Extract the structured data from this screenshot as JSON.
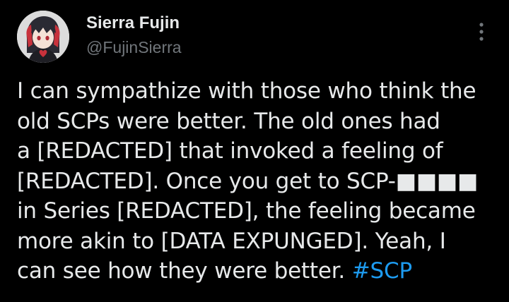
{
  "author": {
    "display_name": "Sierra Fujin",
    "handle": "@FujinSierra",
    "avatar_icon": "anime-avatar-icon"
  },
  "more_icon": "vertical-ellipsis-icon",
  "tweet": {
    "lines": [
      "I can sympathize with those who think the",
      "old SCPs were better. The old ones had",
      "a [REDACTED] that invoked a feeling of",
      "[REDACTED]. Once you get to SCP-■■■■",
      "in Series [REDACTED], the feeling became",
      "more akin to [DATA EXPUNGED]. Yeah, I"
    ],
    "last_line_text": "can see how they were better. ",
    "hashtag": "#SCP"
  },
  "colors": {
    "background": "#000000",
    "text": "#e7e9ea",
    "secondary_text": "#71767b",
    "link": "#1d9bf0"
  }
}
